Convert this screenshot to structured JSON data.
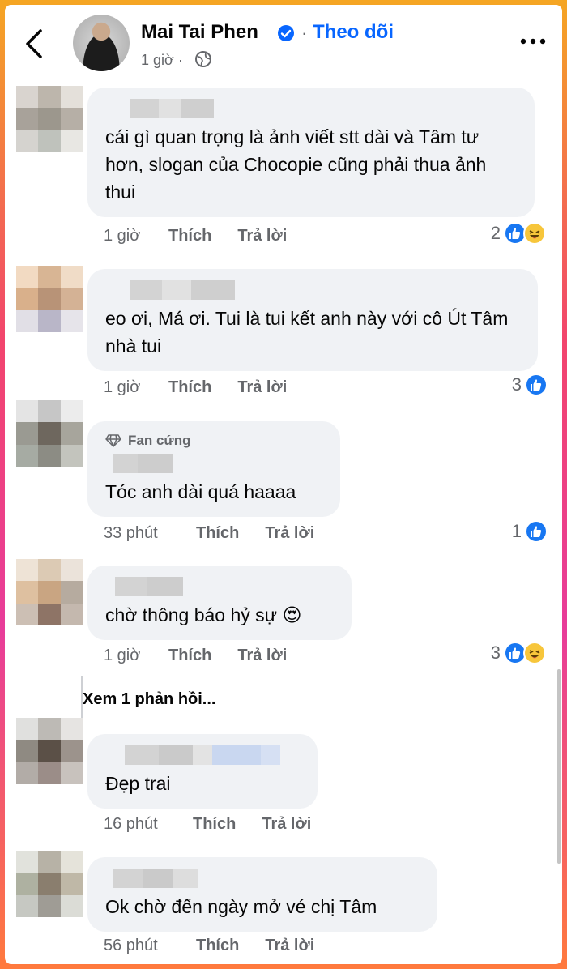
{
  "header": {
    "name": "Mai Tai Phen",
    "separator": "·",
    "follow_label": "Theo dõi",
    "time": "1 giờ ·",
    "icons": [
      "back-arrow-icon",
      "verified-badge-icon",
      "globe-icon",
      "more-options-icon"
    ]
  },
  "colors": {
    "accent": "#0866ff",
    "bubble": "#f0f2f5",
    "secondary_text": "#65676b",
    "like_blue": "#1877f2",
    "haha_yellow": "#f7c63b"
  },
  "comments": [
    {
      "text": "cái gì quan trọng là ảnh viết stt dài và Tâm tư hơn, slogan của Chocopie cũng phải thua ảnh thui",
      "time": "1 giờ",
      "like_label": "Thích",
      "reply_label": "Trả lời",
      "reaction_count": "2",
      "reactions": [
        "like",
        "haha"
      ]
    },
    {
      "text": "eo ơi, Má ơi. Tui là tui kết anh này với cô Út Tâm nhà tui",
      "time": "1 giờ",
      "like_label": "Thích",
      "reply_label": "Trả lời",
      "reaction_count": "3",
      "reactions": [
        "like"
      ]
    },
    {
      "badge": "Fan cứng",
      "text": "Tóc anh dài quá haaaa",
      "time": "33 phút",
      "like_label": "Thích",
      "reply_label": "Trả lời",
      "reaction_count": "1",
      "reactions": [
        "like"
      ]
    },
    {
      "text": "chờ thông báo hỷ sự",
      "emoji": "😍",
      "time": "1 giờ",
      "like_label": "Thích",
      "reply_label": "Trả lời",
      "reaction_count": "3",
      "reactions": [
        "like",
        "haha"
      ]
    },
    {
      "text": "Đẹp trai",
      "time": "16 phút",
      "like_label": "Thích",
      "reply_label": "Trả lời"
    },
    {
      "text": "Ok chờ đến ngày mở vé chị Tâm",
      "time": "56 phút",
      "like_label": "Thích",
      "reply_label": "Trả lời"
    }
  ],
  "view_replies_label": "Xem 1 phản hồi..."
}
